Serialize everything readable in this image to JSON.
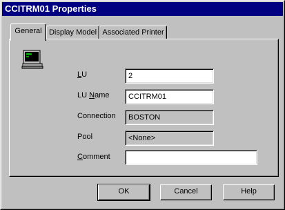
{
  "window": {
    "title": "CCITRM01 Properties"
  },
  "tabs": [
    {
      "label": "General",
      "active": true
    },
    {
      "label": "Display Model",
      "active": false
    },
    {
      "label": "Associated Printer",
      "active": false
    }
  ],
  "general": {
    "icon": "terminal-monitor-icon",
    "fields": {
      "lu": {
        "label_u": "L",
        "label_rest": "U",
        "value": "2"
      },
      "lu_name": {
        "label_pre": "LU ",
        "label_u": "N",
        "label_rest": "ame",
        "value": "CCITRM01"
      },
      "connection": {
        "label": "Connection",
        "value": "BOSTON"
      },
      "pool": {
        "label": "Pool",
        "value": "<None>"
      },
      "comment": {
        "label_u": "C",
        "label_rest": "omment",
        "value": ""
      }
    }
  },
  "buttons": {
    "ok": "OK",
    "cancel": "Cancel",
    "help": "Help"
  }
}
